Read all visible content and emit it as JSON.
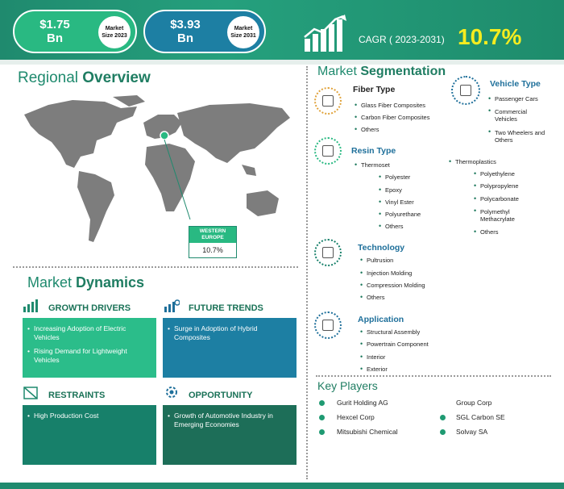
{
  "header": {
    "market_2023": {
      "value": "$1.75\nBn",
      "label": "Market\nSize 2023"
    },
    "market_2031": {
      "value": "$3.93\nBn",
      "label": "Market\nSize 2031"
    },
    "cagr_label": "CAGR ( 2023-2031)",
    "cagr_value": "10.7%"
  },
  "regional": {
    "title_a": "Regional ",
    "title_b": "Overview",
    "region": "WESTERN EUROPE",
    "region_value": "10.7%"
  },
  "segmentation": {
    "title_a": "Market ",
    "title_b": "Segmentation",
    "fiber": {
      "title": "Fiber Type",
      "items": [
        "Glass Fiber Composites",
        "Carbon Fiber Composites",
        "Others"
      ]
    },
    "vehicle": {
      "title": "Vehicle Type",
      "items": [
        "Passenger Cars",
        "Commercial Vehicles",
        "Two Wheelers and Others"
      ]
    },
    "resin": {
      "title": "Resin Type",
      "thermoset": "Thermoset",
      "thermoset_items": [
        "Polyester",
        "Epoxy",
        "Vinyl Ester",
        "Polyurethane",
        "Others"
      ],
      "thermoplastics": "Thermoplastics",
      "thermoplastic_items": [
        "Polyethylene",
        "Polypropylene",
        "Polycarbonate",
        "Polymethyl Methacrylate",
        "Others"
      ]
    },
    "technology": {
      "title": "Technology",
      "items": [
        "Pultrusion",
        "Injection Molding",
        "Compression Molding",
        "Others"
      ]
    },
    "application": {
      "title": "Application",
      "items": [
        "Structural Assembly",
        "Powertrain Component",
        "Interior",
        "Exterior"
      ]
    }
  },
  "dynamics": {
    "title_a": "Market ",
    "title_b": "Dynamics",
    "growth_drivers": {
      "title": "GROWTH DRIVERS",
      "items": [
        "Increasing Adoption of Electric Vehicles",
        "Rising Demand for Lightweight Vehicles"
      ]
    },
    "future_trends": {
      "title": "FUTURE TRENDS",
      "items": [
        "Surge in Adoption of Hybrid Composites"
      ]
    },
    "restraints": {
      "title": "RESTRAINTS",
      "items": [
        "High Production Cost"
      ]
    },
    "opportunity": {
      "title": "OPPORTUNITY",
      "items": [
        "Growth of Automotive Industry in Emerging Economies"
      ]
    }
  },
  "key_players": {
    "title": "Key Players",
    "left": [
      "Gurit Holding AG",
      "Hexcel Corp",
      "Mitsubishi Chemical"
    ],
    "right": [
      "Group Corp",
      "SGL Carbon SE",
      "Solvay SA"
    ]
  },
  "colors": {
    "brand": "#1f8a6e",
    "accent_yellow": "#f6ec1f",
    "blue_pill": "#1d7fa3",
    "light_green": "#2bbd8a",
    "dark_teal": "#17806a"
  }
}
